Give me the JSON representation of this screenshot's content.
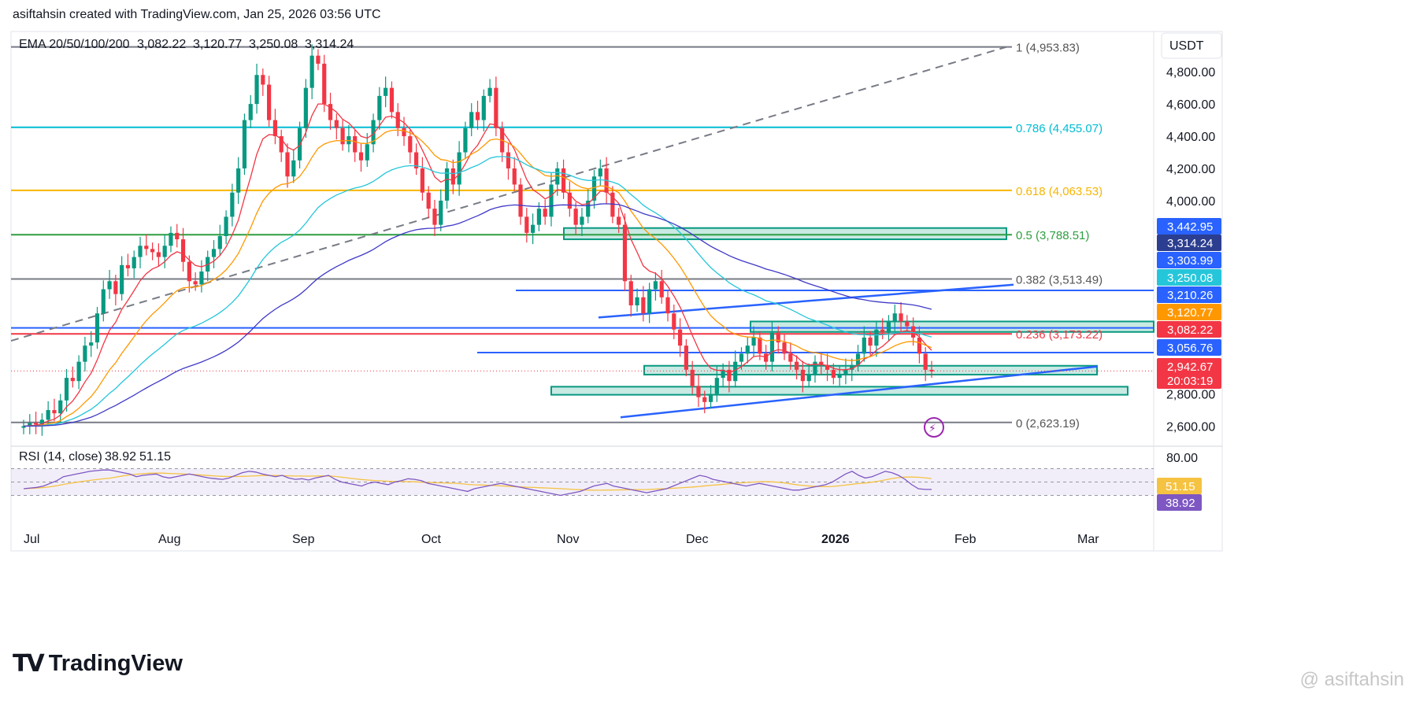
{
  "header": {
    "title": "asiftahsin created with TradingView.com, Jan 25, 2026 03:56 UTC"
  },
  "brand": {
    "logo_mark": "TV",
    "name": "TradingView"
  },
  "watermark": {
    "text": "@ asiftahsin"
  },
  "currency": "USDT",
  "ema_legend": {
    "label": "EMA 20/50/100/200",
    "values": [
      {
        "text": "3,082.22",
        "color": "#f23645"
      },
      {
        "text": "3,120.77",
        "color": "#ff9800"
      },
      {
        "text": "3,250.08",
        "color": "#26c6da"
      },
      {
        "text": "3,314.24",
        "color": "#3f39c6"
      }
    ]
  },
  "rsi_legend": {
    "label": "RSI (14, close)",
    "values": [
      {
        "text": "38.92",
        "color": "#7e57c2"
      },
      {
        "text": "51.15",
        "color": "#f5c242"
      }
    ]
  },
  "chart_data": {
    "type": "candlestick",
    "price_axis": {
      "range": [
        2500,
        5050
      ],
      "ticks": [
        "4,800.00",
        "4,600.00",
        "4,400.00",
        "4,200.00",
        "4,000.00",
        "2,800.00",
        "2,600.00"
      ],
      "tick_values": [
        4800,
        4600,
        4400,
        4200,
        4000,
        2800,
        2600
      ]
    },
    "time_axis": {
      "labels": [
        "Jul",
        "Aug",
        "Sep",
        "Oct",
        "Nov",
        "Dec",
        "2026",
        "Feb",
        "Mar"
      ],
      "bold": [
        "2026"
      ]
    },
    "fib_levels": [
      {
        "label": "1 (4,953.83)",
        "value": 4953.83,
        "color": "#787b86"
      },
      {
        "label": "0.786 (4,455.07)",
        "value": 4455.07,
        "color": "#00bcd4"
      },
      {
        "label": "0.618 (4,063.53)",
        "value": 4063.53,
        "color": "#f7b500"
      },
      {
        "label": "0.5 (3,788.51)",
        "value": 3788.51,
        "color": "#2e9e40"
      },
      {
        "label": "0.382 (3,513.49)",
        "value": 3513.49,
        "color": "#787b86"
      },
      {
        "label": "0.236 (3,173.22)",
        "value": 3173.22,
        "color": "#f23645"
      },
      {
        "label": "0 (2,623.19)",
        "value": 2623.19,
        "color": "#787b86"
      }
    ],
    "price_tags": [
      {
        "text": "3,442.95",
        "bg": "#2962ff",
        "value": 3442.95
      },
      {
        "text": "3,314.24",
        "bg": "#2c3e8f",
        "value": 3314.24
      },
      {
        "text": "3,303.99",
        "bg": "#2962ff",
        "value": 3303.99
      },
      {
        "text": "3,250.08",
        "bg": "#26c6da",
        "value": 3250.08
      },
      {
        "text": "3,210.26",
        "bg": "#2962ff",
        "value": 3210.26
      },
      {
        "text": "3,120.77",
        "bg": "#ff9800",
        "value": 3120.77
      },
      {
        "text": "3,082.22",
        "bg": "#f23645",
        "value": 3082.22
      },
      {
        "text": "3,056.76",
        "bg": "#2962ff",
        "value": 3056.76
      },
      {
        "text": "2,942.67",
        "bg": "#f23645",
        "value": 2942.67
      },
      {
        "text": "20:03:19",
        "bg": "#f23645",
        "value": 2890
      }
    ],
    "rsi_axis": {
      "ticks": [
        "80.00"
      ],
      "tags": [
        {
          "text": "51.15",
          "bg": "#f5c242",
          "fg": "#131722",
          "value": 51.15
        },
        {
          "text": "38.92",
          "bg": "#7e57c2",
          "fg": "#ffffff",
          "value": 38.92
        }
      ],
      "upper": 70,
      "lower": 30
    },
    "ohlc_path_closes": [
      2600,
      2620,
      2610,
      2640,
      2700,
      2680,
      2760,
      2900,
      2880,
      3000,
      3100,
      3120,
      3300,
      3450,
      3500,
      3420,
      3600,
      3580,
      3650,
      3720,
      3700,
      3680,
      3650,
      3720,
      3800,
      3760,
      3620,
      3500,
      3480,
      3560,
      3650,
      3700,
      3780,
      3900,
      4050,
      4200,
      4500,
      4600,
      4780,
      4720,
      4500,
      4400,
      4300,
      4150,
      4250,
      4450,
      4700,
      4900,
      4850,
      4600,
      4500,
      4450,
      4350,
      4400,
      4300,
      4250,
      4350,
      4500,
      4650,
      4700,
      4550,
      4450,
      4400,
      4300,
      4200,
      4050,
      3950,
      3850,
      4000,
      4200,
      4100,
      4300,
      4450,
      4550,
      4500,
      4650,
      4700,
      4450,
      4300,
      4200,
      4100,
      3900,
      3800,
      3850,
      3950,
      3900,
      4100,
      4200,
      4050,
      3950,
      3850,
      3900,
      4000,
      4150,
      4200,
      4050,
      3900,
      3850,
      3500,
      3350,
      3400,
      3300,
      3450,
      3500,
      3400,
      3300,
      3200,
      3100,
      2950,
      2850,
      2780,
      2750,
      2800,
      2900,
      2950,
      2880,
      3000,
      3050,
      3100,
      3150,
      3050,
      3000,
      3180,
      3120,
      3050,
      3000,
      2950,
      2880,
      2920,
      3000,
      2980,
      2950,
      2900,
      2920,
      2950,
      2980,
      3050,
      3150,
      3100,
      3200,
      3180,
      3250,
      3300,
      3250,
      3220,
      3150,
      3050,
      2950,
      2940
    ],
    "rsi_values": [
      40,
      41,
      42,
      44,
      48,
      52,
      58,
      60,
      62,
      64,
      66,
      67,
      68,
      68,
      66,
      64,
      62,
      58,
      60,
      61,
      62,
      58,
      56,
      58,
      60,
      62,
      60,
      58,
      56,
      55,
      54,
      56,
      60,
      64,
      66,
      65,
      62,
      60,
      58,
      60,
      56,
      54,
      55,
      53,
      56,
      58,
      60,
      54,
      50,
      48,
      46,
      44,
      48,
      50,
      48,
      46,
      50,
      52,
      55,
      54,
      52,
      48,
      46,
      44,
      42,
      40,
      38,
      36,
      40,
      42,
      44,
      46,
      48,
      46,
      44,
      42,
      40,
      38,
      36,
      34,
      32,
      30,
      32,
      34,
      36,
      40,
      44,
      46,
      48,
      44,
      42,
      40,
      38,
      36,
      34,
      36,
      38,
      40,
      44,
      48,
      52,
      56,
      60,
      58,
      54,
      52,
      50,
      48,
      46,
      44,
      46,
      48,
      46,
      44,
      42,
      40,
      38,
      38,
      40,
      42,
      44,
      46,
      50,
      56,
      62,
      66,
      60,
      56,
      58,
      62,
      66,
      64,
      60,
      54,
      46,
      40,
      39,
      39
    ]
  }
}
